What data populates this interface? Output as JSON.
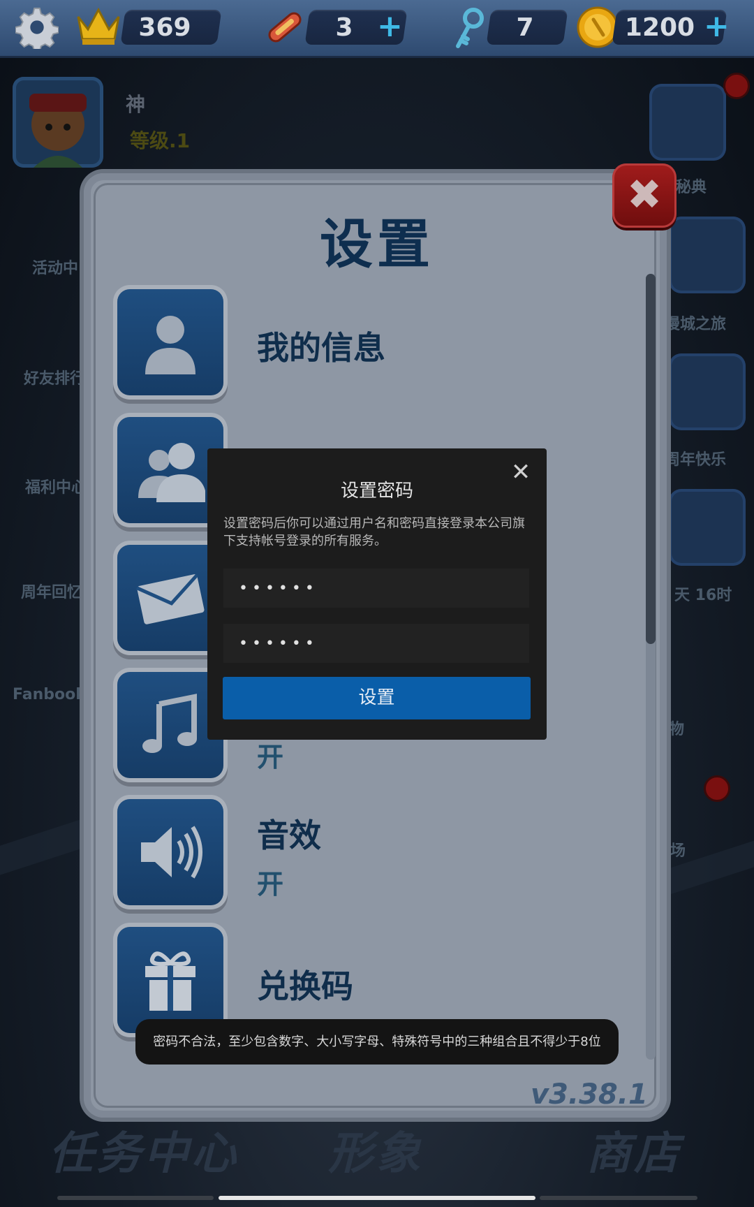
{
  "top_bar": {
    "settings_icon": "gear-icon",
    "crown_icon": "crown-icon",
    "crown_value": "369",
    "hoverboard_icon": "hoverboard-icon",
    "hoverboard_value": "3",
    "key_icon": "key-icon",
    "key_value": "7",
    "coin_icon": "coin-icon",
    "coin_value": "1200",
    "plus": "+"
  },
  "player": {
    "name": "神",
    "level": "等级.1"
  },
  "left_widgets": [
    "活动中",
    "好友排行",
    "福利中心",
    "周年回忆",
    "Fanbook"
  ],
  "right_widgets": [
    "秘典",
    "漫城之旅",
    "周年快乐",
    "天 16时",
    "物",
    "场"
  ],
  "bottom_nav": [
    "任务中心",
    "形象",
    "商店"
  ],
  "settings": {
    "title": "设置",
    "close_symbol": "✖",
    "rows": [
      {
        "label": "我的信息",
        "sub": "",
        "icon": "user-icon"
      },
      {
        "label": "",
        "sub": "",
        "icon": "friends-icon"
      },
      {
        "label": "",
        "sub": "",
        "icon": "mail-icon"
      },
      {
        "label": "",
        "sub": "开",
        "icon": "music-icon"
      },
      {
        "label": "音效",
        "sub": "开",
        "icon": "speaker-icon"
      },
      {
        "label": "兑换码",
        "sub": "",
        "icon": "gift-icon"
      }
    ],
    "version": "v3.38.1"
  },
  "password_dialog": {
    "title": "设置密码",
    "close_symbol": "✕",
    "description": "设置密码后你可以通过用户名和密码直接登录本公司旗下支持帐号登录的所有服务。",
    "password_value": "••••••",
    "confirm_value": "••••••",
    "submit_label": "设置"
  },
  "toast": {
    "message": "密码不合法，至少包含数字、大小写字母、特殊符号中的三种组合且不得少于8位"
  },
  "colors": {
    "accent_blue": "#0a5ea9",
    "panel_title": "#0e2e4f",
    "close_red": "#a11c1c"
  }
}
